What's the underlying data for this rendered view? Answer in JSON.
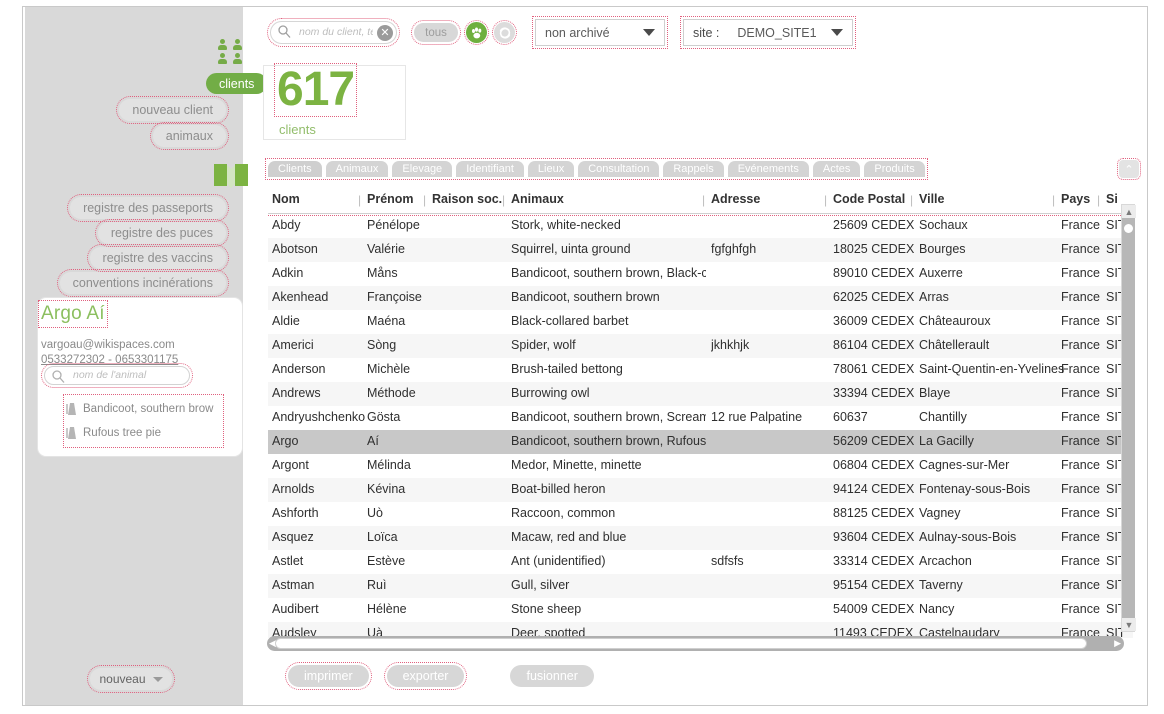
{
  "sidebar": {
    "clients_icon": "people-icon",
    "clients_pill": "clients",
    "buttons": [
      {
        "label": "nouveau client",
        "name": "nouveau-client-button"
      },
      {
        "label": "animaux",
        "name": "animaux-button"
      }
    ],
    "book_icon": "book-icon",
    "registers": [
      {
        "label": "registre des passeports",
        "name": "registre-passeports-button"
      },
      {
        "label": "registre des puces",
        "name": "registre-puces-button"
      },
      {
        "label": "registre des vaccins",
        "name": "registre-vaccins-button"
      },
      {
        "label": "conventions incinérations",
        "name": "conventions-incinerations-button"
      }
    ],
    "client_card": {
      "name": "Argo Aí",
      "email": "vargoau@wikispaces.com",
      "phones": "0533272302 - 0653301175",
      "animal_search_placeholder": "nom de l'animal",
      "animals": [
        "Bandicoot, southern brow",
        "Rufous tree pie"
      ]
    },
    "nouveau_button": "nouveau"
  },
  "toolbar": {
    "search_placeholder": "nom du client, télép",
    "clear_icon": "✕",
    "tous_label": "tous",
    "paw_icon": "paw-icon",
    "sync_icon": "sync-icon",
    "archive_select": "non archivé",
    "site_label": "site :",
    "site_select": "DEMO_SITE1"
  },
  "counter": {
    "value": "617",
    "label": "clients"
  },
  "tabs": [
    {
      "label": "Clients",
      "active": true
    },
    {
      "label": "Animaux",
      "active": false
    },
    {
      "label": "Elevage",
      "active": false
    },
    {
      "label": "Identifiant",
      "active": false
    },
    {
      "label": "Lieux",
      "active": false
    },
    {
      "label": "Consultation",
      "active": false
    },
    {
      "label": "Rappels",
      "active": false
    },
    {
      "label": "Evénements",
      "active": false
    },
    {
      "label": "Actes",
      "active": false
    },
    {
      "label": "Produits",
      "active": false
    }
  ],
  "tab_collapse_icon": "⌃",
  "table": {
    "columns": [
      "Nom",
      "Prénom",
      "Raison soc.",
      "Animaux",
      "Adresse",
      "Code Postal",
      "Ville",
      "Pays",
      "Si"
    ],
    "rows": [
      {
        "nom": "Abdy",
        "prenom": "Pénélope",
        "raison": "",
        "animaux": "Stork, white-necked",
        "adresse": "",
        "cp": "25609 CEDEX",
        "ville": "Sochaux",
        "pays": "France",
        "site": "SIT"
      },
      {
        "nom": "Abotson",
        "prenom": "Valérie",
        "raison": "",
        "animaux": "Squirrel, uinta ground",
        "adresse": "fgfghfgh",
        "cp": "18025 CEDEX",
        "ville": "Bourges",
        "pays": "France",
        "site": "SIT"
      },
      {
        "nom": "Adkin",
        "prenom": "Måns",
        "raison": "",
        "animaux": "Bandicoot, southern brown, Black-ch",
        "adresse": "",
        "cp": "89010 CEDEX",
        "ville": "Auxerre",
        "pays": "France",
        "site": "SIT"
      },
      {
        "nom": "Akenhead",
        "prenom": "Françoise",
        "raison": "",
        "animaux": "Bandicoot, southern brown",
        "adresse": "",
        "cp": "62025 CEDEX",
        "ville": "Arras",
        "pays": "France",
        "site": "SIT"
      },
      {
        "nom": "Aldie",
        "prenom": "Maéna",
        "raison": "",
        "animaux": "Black-collared barbet",
        "adresse": "",
        "cp": "36009 CEDEX",
        "ville": "Châteauroux",
        "pays": "France",
        "site": "SIT"
      },
      {
        "nom": "Americi",
        "prenom": "Sòng",
        "raison": "",
        "animaux": "Spider, wolf",
        "adresse": "jkhkhjk",
        "cp": "86104 CEDEX",
        "ville": "Châtellerault",
        "pays": "France",
        "site": "SIT"
      },
      {
        "nom": "Anderson",
        "prenom": "Michèle",
        "raison": "",
        "animaux": "Brush-tailed bettong",
        "adresse": "",
        "cp": "78061 CEDEX",
        "ville": "Saint-Quentin-en-Yvelines",
        "pays": "France",
        "site": "SIT"
      },
      {
        "nom": "Andrews",
        "prenom": "Méthode",
        "raison": "",
        "animaux": "Burrowing owl",
        "adresse": "",
        "cp": "33394 CEDEX",
        "ville": "Blaye",
        "pays": "France",
        "site": "SIT"
      },
      {
        "nom": "Andryushchenko",
        "prenom": "Gösta",
        "raison": "",
        "animaux": "Bandicoot, southern brown, Screame",
        "adresse": "12 rue Palpatine",
        "cp": "60637",
        "ville": "Chantilly",
        "pays": "France",
        "site": "SIT"
      },
      {
        "nom": "Argo",
        "prenom": "Aí",
        "raison": "",
        "animaux": "Bandicoot, southern brown, Rufous t",
        "adresse": "",
        "cp": "56209 CEDEX",
        "ville": "La Gacilly",
        "pays": "France",
        "site": "SIT",
        "selected": true
      },
      {
        "nom": "Argont",
        "prenom": "Mélinda",
        "raison": "",
        "animaux": "Medor, Minette, minette",
        "adresse": "",
        "cp": "06804 CEDEX",
        "ville": "Cagnes-sur-Mer",
        "pays": "France",
        "site": "SIT"
      },
      {
        "nom": "Arnolds",
        "prenom": "Kévina",
        "raison": "",
        "animaux": "Boat-billed heron",
        "adresse": "",
        "cp": "94124 CEDEX",
        "ville": "Fontenay-sous-Bois",
        "pays": "France",
        "site": "SIT"
      },
      {
        "nom": "Ashforth",
        "prenom": "Uò",
        "raison": "",
        "animaux": "Raccoon, common",
        "adresse": "",
        "cp": "88125 CEDEX",
        "ville": "Vagney",
        "pays": "France",
        "site": "SIT"
      },
      {
        "nom": "Asquez",
        "prenom": "Loïca",
        "raison": "",
        "animaux": "Macaw, red and blue",
        "adresse": "",
        "cp": "93604 CEDEX",
        "ville": "Aulnay-sous-Bois",
        "pays": "France",
        "site": "SIT"
      },
      {
        "nom": "Astlet",
        "prenom": "Estève",
        "raison": "",
        "animaux": "Ant (unidentified)",
        "adresse": "sdfsfs",
        "cp": "33314 CEDEX",
        "ville": "Arcachon",
        "pays": "France",
        "site": "SIT"
      },
      {
        "nom": "Astman",
        "prenom": "Ruì",
        "raison": "",
        "animaux": "Gull, silver",
        "adresse": "",
        "cp": "95154 CEDEX",
        "ville": "Taverny",
        "pays": "France",
        "site": "SIT"
      },
      {
        "nom": "Audibert",
        "prenom": "Hélène",
        "raison": "",
        "animaux": "Stone sheep",
        "adresse": "",
        "cp": "54009 CEDEX",
        "ville": "Nancy",
        "pays": "France",
        "site": "SIT"
      },
      {
        "nom": "Audsley",
        "prenom": "Uà",
        "raison": "",
        "animaux": "Deer, spotted",
        "adresse": "",
        "cp": "11493 CEDEX",
        "ville": "Castelnaudary",
        "pays": "France",
        "site": "SIT"
      }
    ]
  },
  "footer_buttons": [
    {
      "label": "imprimer",
      "name": "imprimer-button"
    },
    {
      "label": "exporter",
      "name": "exporter-button"
    },
    {
      "label": "fusionner",
      "name": "fusionner-button"
    }
  ],
  "colors": {
    "accent_green": "#7cb342",
    "pill_gray": "#e2e2e2",
    "selected_row": "#c8c8c8",
    "dotted_highlight": "#e0607e"
  }
}
